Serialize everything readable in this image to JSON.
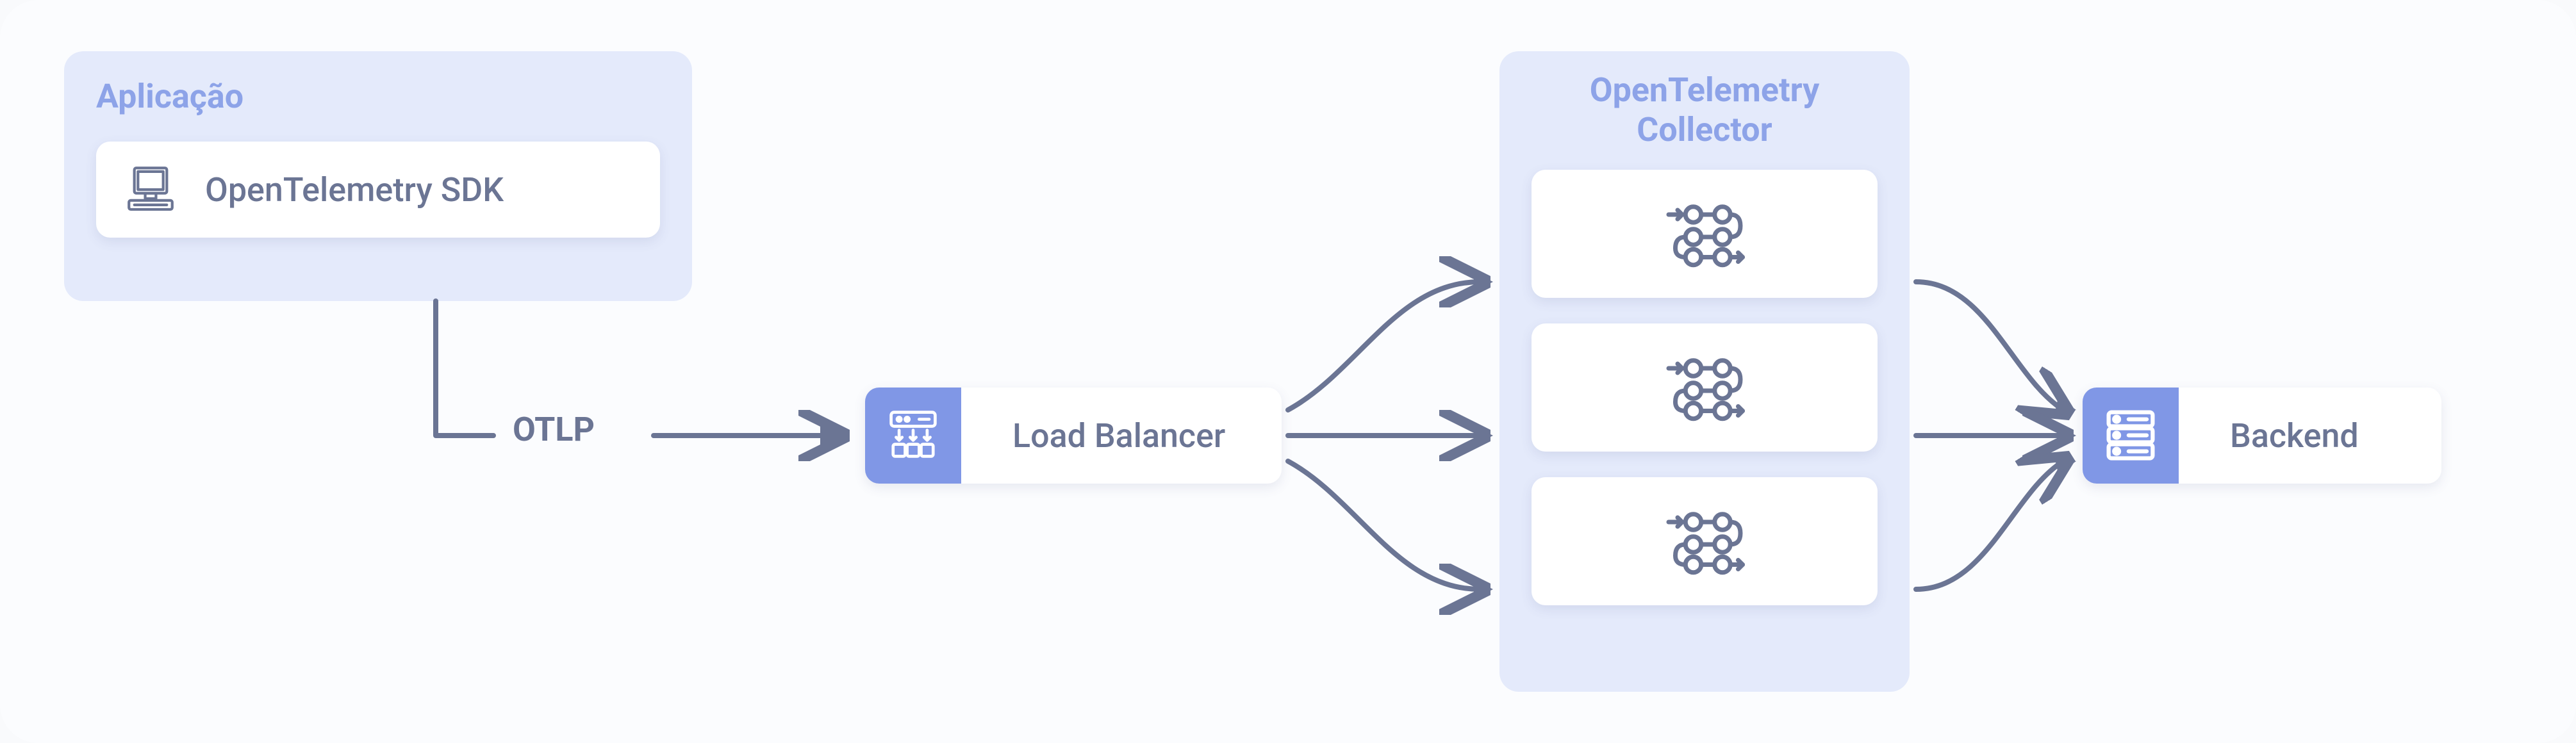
{
  "application": {
    "title": "Aplicação",
    "sdk_label": "OpenTelemetry SDK"
  },
  "otlp_label": "OTLP",
  "load_balancer": {
    "label": "Load Balancer"
  },
  "collector": {
    "title_line1": "OpenTelemetry",
    "title_line2": "Collector"
  },
  "backend": {
    "label": "Backend"
  },
  "colors": {
    "accent": "#8097e6",
    "panel": "#e4eafb",
    "text": "#6b7594",
    "title": "#8da3e8",
    "arrow": "#6b7594"
  }
}
